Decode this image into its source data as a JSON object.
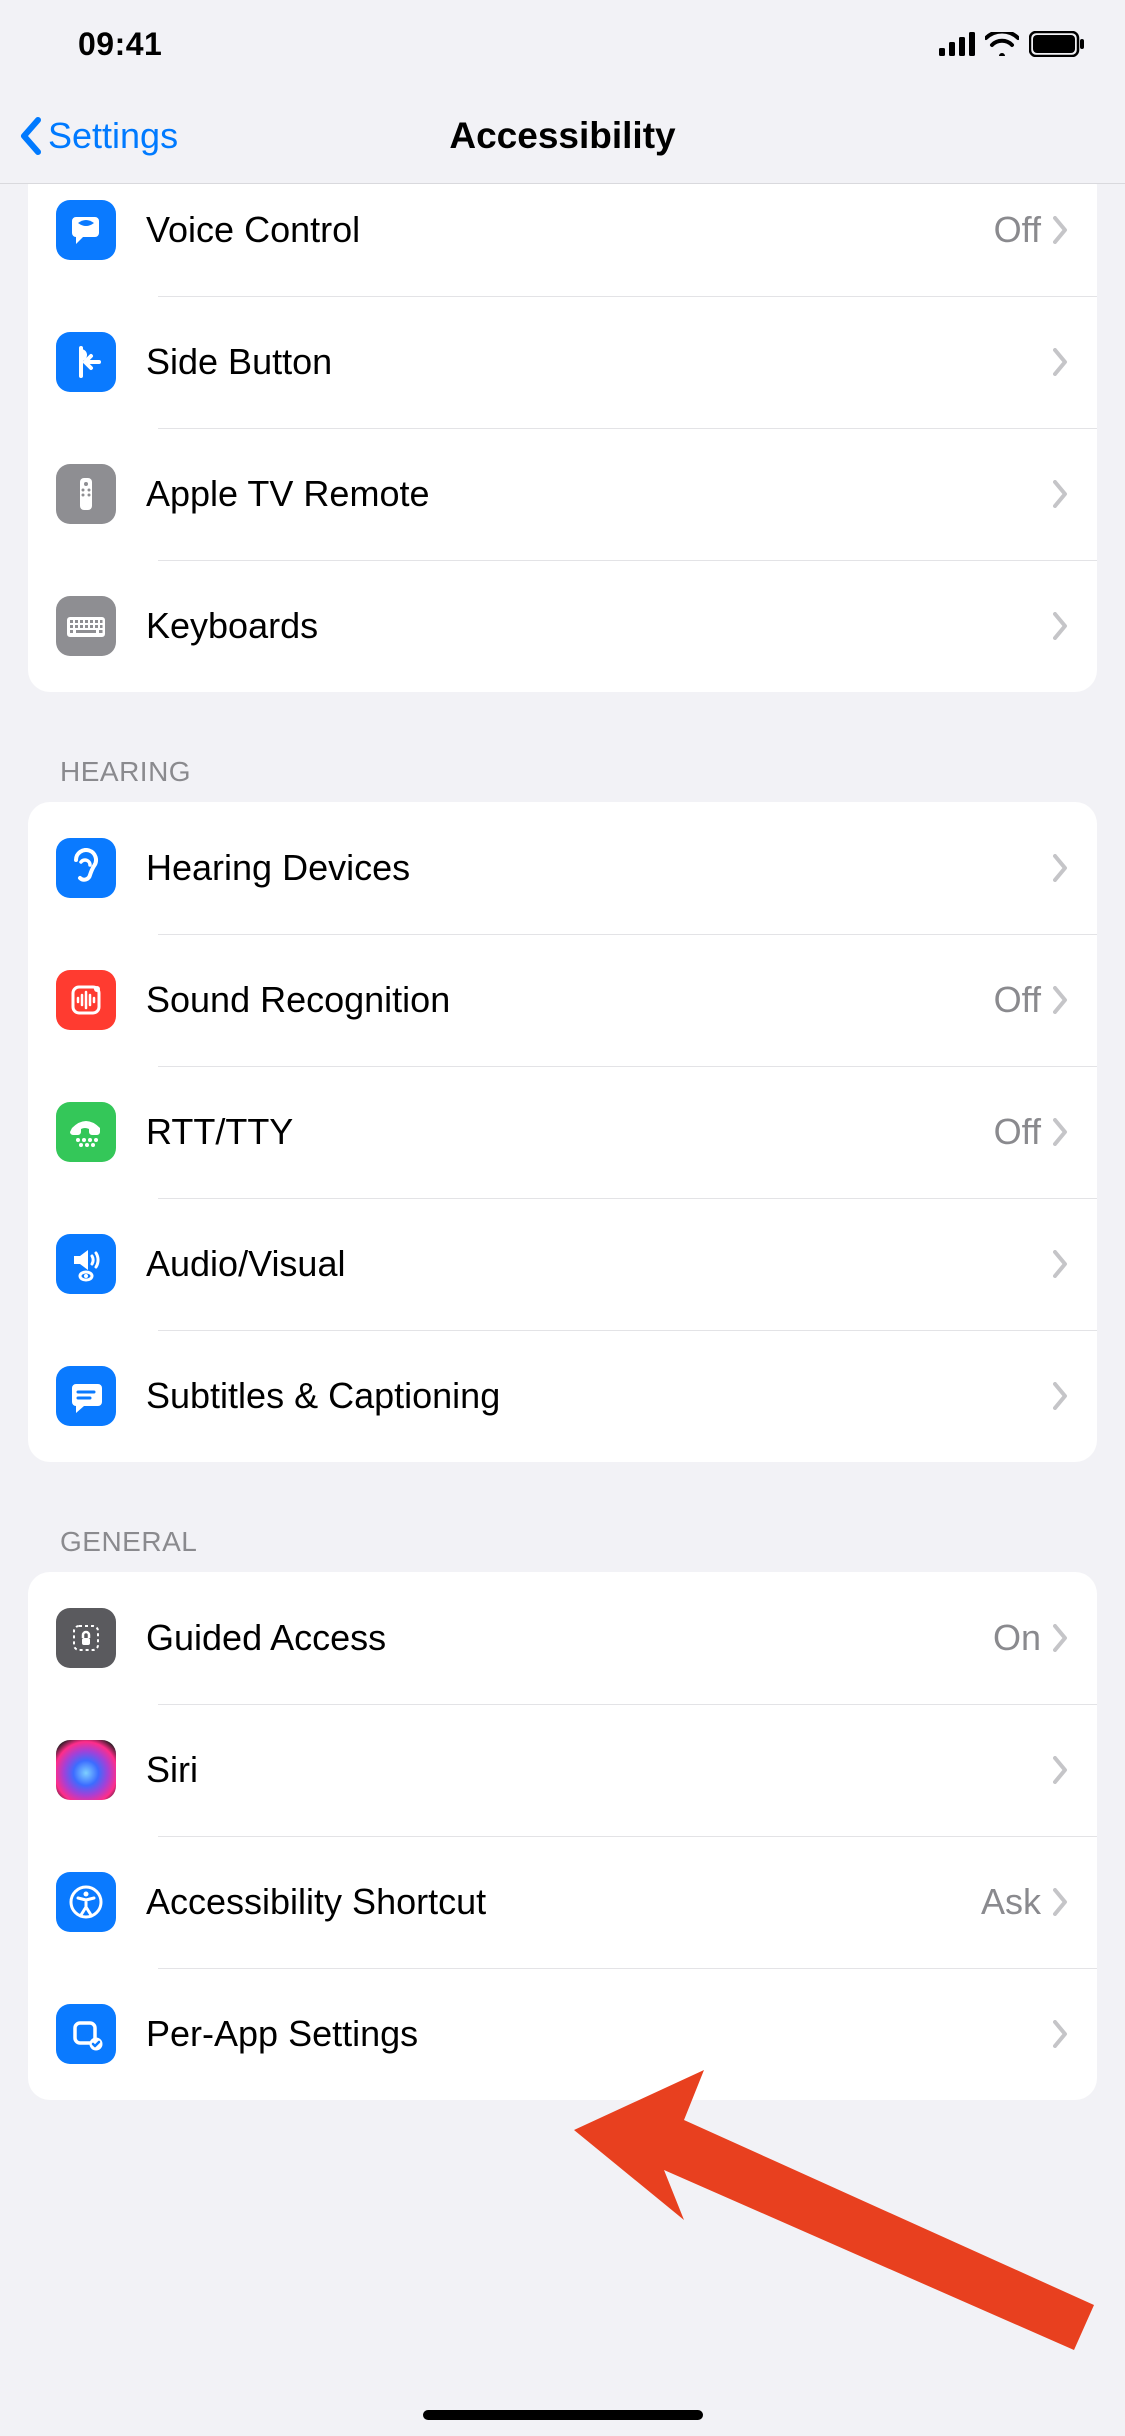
{
  "status": {
    "time": "09:41"
  },
  "nav": {
    "back_label": "Settings",
    "title": "Accessibility"
  },
  "sections": {
    "partial": {
      "items": [
        {
          "label": "Voice Control",
          "value": "Off"
        },
        {
          "label": "Side Button",
          "value": ""
        },
        {
          "label": "Apple TV Remote",
          "value": ""
        },
        {
          "label": "Keyboards",
          "value": ""
        }
      ]
    },
    "hearing": {
      "header": "Hearing",
      "items": [
        {
          "label": "Hearing Devices",
          "value": ""
        },
        {
          "label": "Sound Recognition",
          "value": "Off"
        },
        {
          "label": "RTT/TTY",
          "value": "Off"
        },
        {
          "label": "Audio/Visual",
          "value": ""
        },
        {
          "label": "Subtitles & Captioning",
          "value": ""
        }
      ]
    },
    "general": {
      "header": "General",
      "items": [
        {
          "label": "Guided Access",
          "value": "On"
        },
        {
          "label": "Siri",
          "value": ""
        },
        {
          "label": "Accessibility Shortcut",
          "value": "Ask"
        },
        {
          "label": "Per-App Settings",
          "value": ""
        }
      ]
    }
  }
}
